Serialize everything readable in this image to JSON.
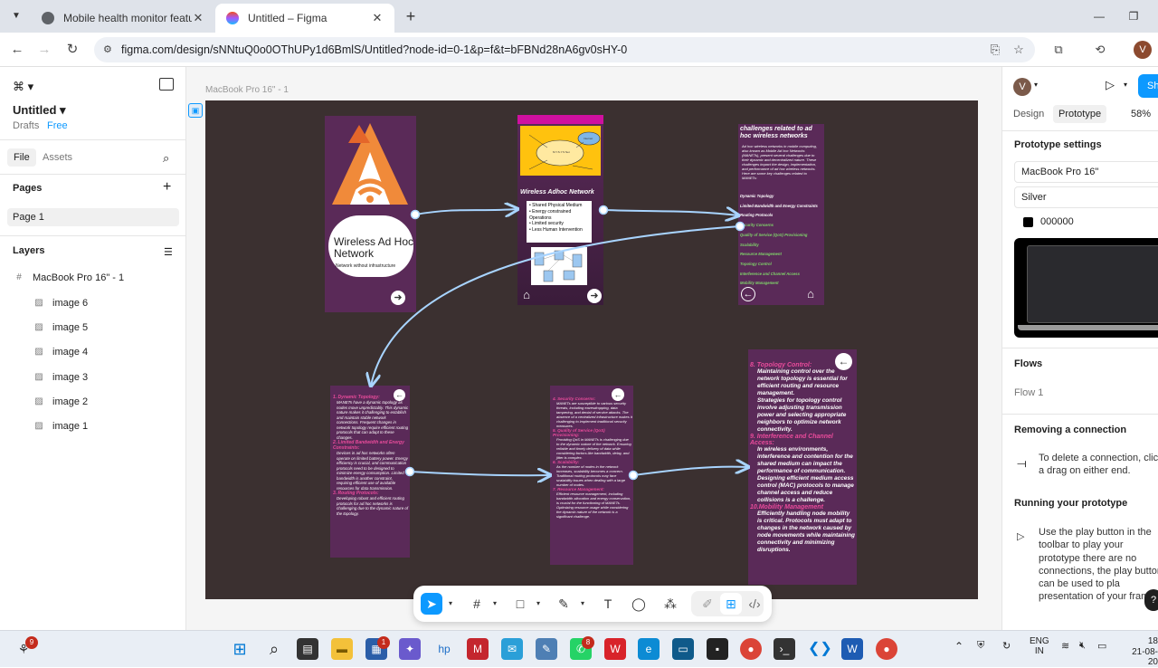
{
  "browser": {
    "tabs": [
      {
        "title": "Mobile health monitor features",
        "active": false
      },
      {
        "title": "Untitled – Figma",
        "active": true
      }
    ],
    "url": "figma.com/design/sNNtuQ0o0OThUPy1d6BmlS/Untitled?node-id=0-1&p=f&t=bFBNd28nA6gv0sHY-0",
    "profile_initial": "V"
  },
  "left_panel": {
    "file_title": "Untitled",
    "drafts": "Drafts",
    "plan": "Free",
    "tabs": [
      "File",
      "Assets"
    ],
    "pages_title": "Pages",
    "pages": [
      "Page 1"
    ],
    "layers_title": "Layers",
    "frame_layer": "MacBook Pro 16\" - 1",
    "layers": [
      "image 6",
      "image 5",
      "image 4",
      "image 3",
      "image 2",
      "image 1"
    ]
  },
  "canvas": {
    "frame_label": "MacBook Pro 16\" - 1",
    "screens": {
      "s1": {
        "title": "Wireless Ad Hoc Network",
        "subtitle": "Network without infrastructure"
      },
      "s2": {
        "title": "Wireless Adhoc Network",
        "bullets": [
          "Shared Physical Medium",
          "Energy constrained Operations",
          "Limited security",
          "Less Human Intervention"
        ],
        "cloud_labels": [
          "M.Y.S.Y.S Net",
          "Internet"
        ]
      },
      "s3": {
        "title": "challenges related to ad hoc wireless networks",
        "body": "Ad hoc wireless networks in mobile computing, also known as Mobile Ad hoc Networks (MANETs), present several challenges due to their dynamic and decentralized nature. These challenges impact the design, implementation, and performance of ad hoc wireless networks. Here are some key challenges related to MANETs:",
        "items": [
          "Dynamic Topology",
          "Limited Bandwidth and Energy Constraints",
          "Routing Protocols",
          "Security Concerns",
          "Quality of Service (QoS) Provisioning",
          "Scalability",
          "Resource Management",
          "Topology Control",
          "Interference and Channel Access",
          "Mobility Management"
        ]
      },
      "s4": {
        "sections": [
          {
            "h": "1. Dynamic Topology:",
            "p": "MANETs have a dynamic topology as nodes move unpredictably. This dynamic nature makes it challenging to establish and maintain stable network connections. Frequent changes in network topology require efficient routing protocols that can adapt to these changes."
          },
          {
            "h": "2. Limited Bandwidth and Energy Constraints:",
            "p": "Devices in ad hoc networks often operate on limited battery power. Energy efficiency is crucial, and communication protocols need to be designed to minimize energy consumption. Limited bandwidth is another constraint, requiring efficient use of available resources for data transmission."
          },
          {
            "h": "3. Routing Protocols:",
            "p": "Developing robust and efficient routing protocols for ad hoc networks is challenging due to the dynamic nature of the topology."
          }
        ]
      },
      "s5": {
        "sections": [
          {
            "h": "4. Security Concerns:",
            "p": "MANETs are susceptible to various security threats, including eavesdropping, data tampering, and denial of service attacks. The absence of a centralized infrastructure makes it challenging to implement traditional security measures."
          },
          {
            "h": "5. Quality of Service (QoS) Provisioning:",
            "p": "Providing QoS in MANETs is challenging due to the dynamic nature of the network. Ensuring reliable and timely delivery of data while considering factors like bandwidth, delay, and jitter is complex."
          },
          {
            "h": "6. Scalability:",
            "p": "As the number of nodes in the network increases, scalability becomes a concern. Traditional routing protocols may face scalability issues when dealing with a large number of nodes."
          },
          {
            "h": "7. Resource Management:",
            "p": "Efficient resource management, including bandwidth allocation and energy conservation, is crucial for the functioning of MANETs. Optimizing resource usage while considering the dynamic nature of the network is a significant challenge."
          }
        ]
      },
      "s6": {
        "sections": [
          {
            "h": "8. Topology Control:",
            "p": [
              "Maintaining control over the network topology is essential for efficient routing and resource management.",
              "Strategies for topology control involve adjusting transmission power and selecting appropriate neighbors to optimize network connectivity."
            ]
          },
          {
            "h": "9. Interference and Channel Access:",
            "p": [
              "In wireless environments, interference and contention for the shared medium can impact the performance of communication.",
              "Designing efficient medium access control (MAC) protocols to manage channel access and reduce collisions is a challenge."
            ]
          },
          {
            "h": "10.Mobility Management",
            "p": [
              "Efficiently handling node mobility is critical. Protocols must adapt to changes in the network caused by node movements while maintaining connectivity and minimizing disruptions."
            ]
          }
        ]
      }
    }
  },
  "right_panel": {
    "user_initial": "V",
    "share_label": "Sh",
    "tabs": [
      "Design",
      "Prototype"
    ],
    "zoom": "58%",
    "prototype_settings": "Prototype settings",
    "device": "MacBook Pro 16\"",
    "model": "Silver",
    "bg_color": "000000",
    "flows_title": "Flows",
    "flow_1": "Flow 1",
    "removing_title": "Removing a connection",
    "removing_text": "To delete a connection, click a drag on either end.",
    "running_title": "Running your prototype",
    "running_text": "Use the play button in the toolbar to play your prototype there are no connections, the play button can be used to pla presentation of your frames."
  },
  "taskbar": {
    "badges": {
      "start": "9",
      "store": "1",
      "whatsapp": "8"
    },
    "lang": "ENG",
    "region": "IN",
    "time": "18",
    "date": "21-08-20"
  }
}
